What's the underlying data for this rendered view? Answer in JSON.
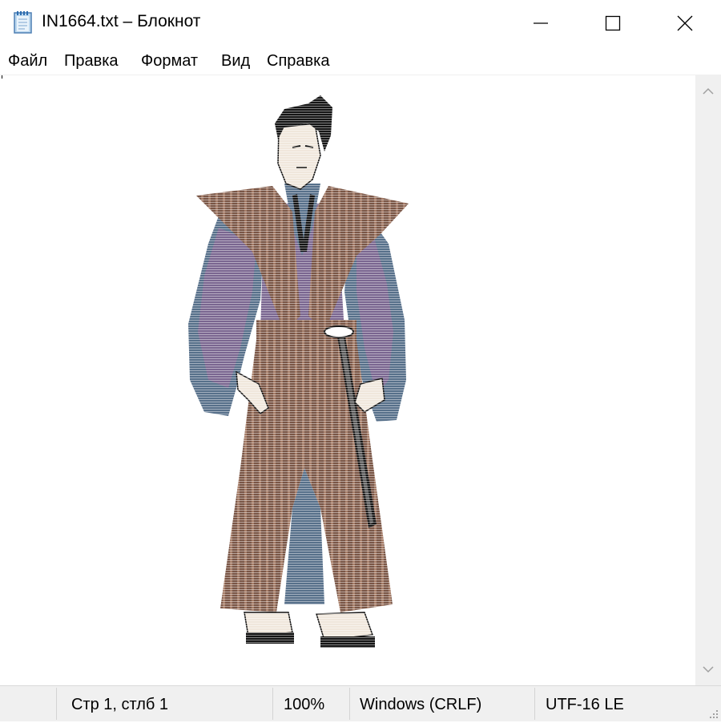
{
  "window": {
    "title": "IN1664.txt – Блокнот",
    "icon": "notepad-icon",
    "controls": [
      "minimize-icon",
      "maximize-icon",
      "close-icon"
    ]
  },
  "menu": {
    "items": [
      "Файл",
      "Правка",
      "Формат",
      "Вид",
      "Справка"
    ]
  },
  "editor": {
    "content_description_icon": "samurai-ascii-art",
    "colors": {
      "robe_brown": "#7a5646",
      "robe_stripe": "#b58a73",
      "kimono_blue": "#57708a",
      "kimono_purple": "#7a6690",
      "skin": "#f0e7dc",
      "hair": "#151515"
    }
  },
  "scrollbar": {
    "up_icon": "chevron-up-icon",
    "down_icon": "chevron-down-icon"
  },
  "status": {
    "position": "Стр 1, стлб 1",
    "zoom": "100%",
    "line_ending": "Windows (CRLF)",
    "encoding": "UTF-16 LE"
  }
}
